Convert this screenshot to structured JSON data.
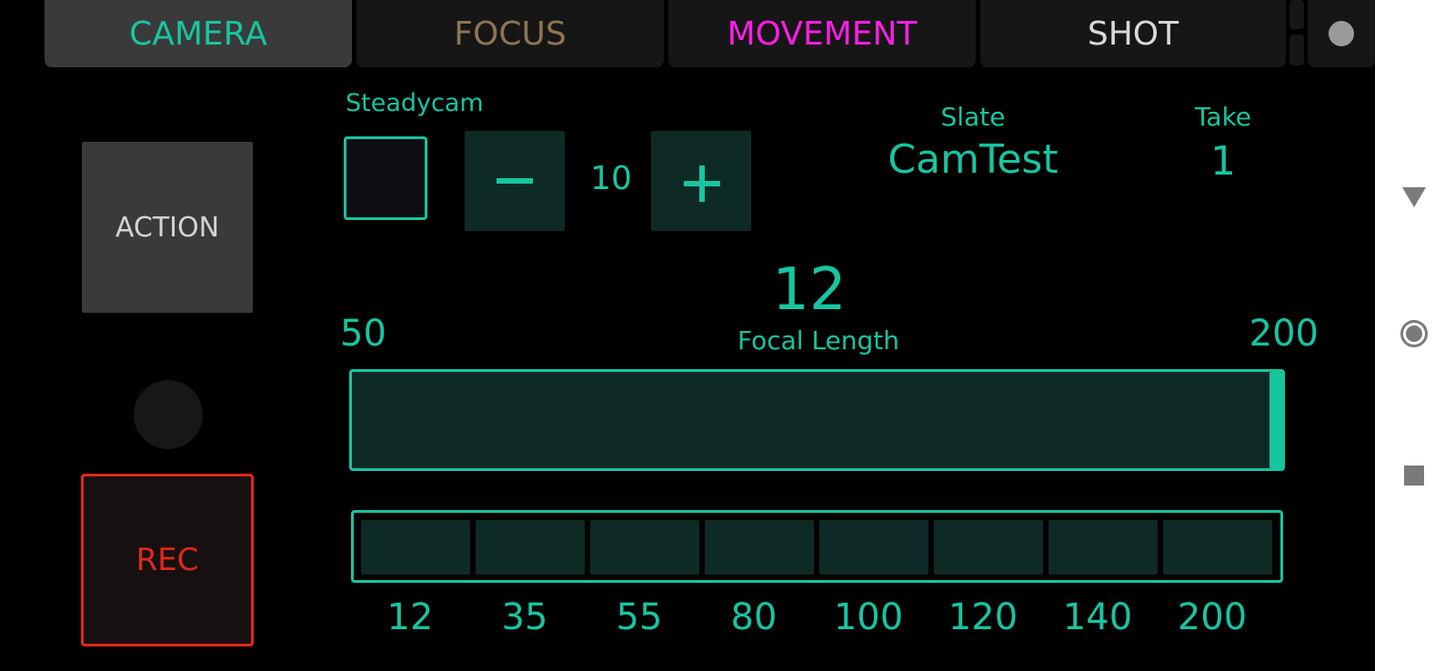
{
  "tabs": [
    {
      "label": "CAMERA",
      "color": "#17c5a1",
      "active": true
    },
    {
      "label": "FOCUS",
      "color": "#8e7453",
      "active": false
    },
    {
      "label": "MOVEMENT",
      "color": "#ff1ee3",
      "active": false
    },
    {
      "label": "SHOT",
      "color": "#d8d8d8",
      "active": false
    }
  ],
  "left_panel": {
    "action_label": "ACTION",
    "rec_label": "REC"
  },
  "steadycam": {
    "label": "Steadycam",
    "checked": false
  },
  "stepper": {
    "value": "10",
    "minus_icon": "minus-icon",
    "plus_icon": "plus-icon"
  },
  "slate": {
    "label": "Slate",
    "value": "CamTest"
  },
  "take": {
    "label": "Take",
    "value": "1"
  },
  "focal": {
    "value": "12",
    "label": "Focal Length",
    "min": "50",
    "max": "200",
    "slider_position_fraction": 1.0
  },
  "presets": [
    "12",
    "35",
    "55",
    "80",
    "100",
    "120",
    "140",
    "200"
  ],
  "colors": {
    "accent": "#17c5a1",
    "rec": "#e3261d",
    "panel": "#0e2a27"
  },
  "system_nav": {
    "back_icon": "back-triangle-icon",
    "home_icon": "home-circle-icon",
    "recents_icon": "recents-square-icon"
  }
}
